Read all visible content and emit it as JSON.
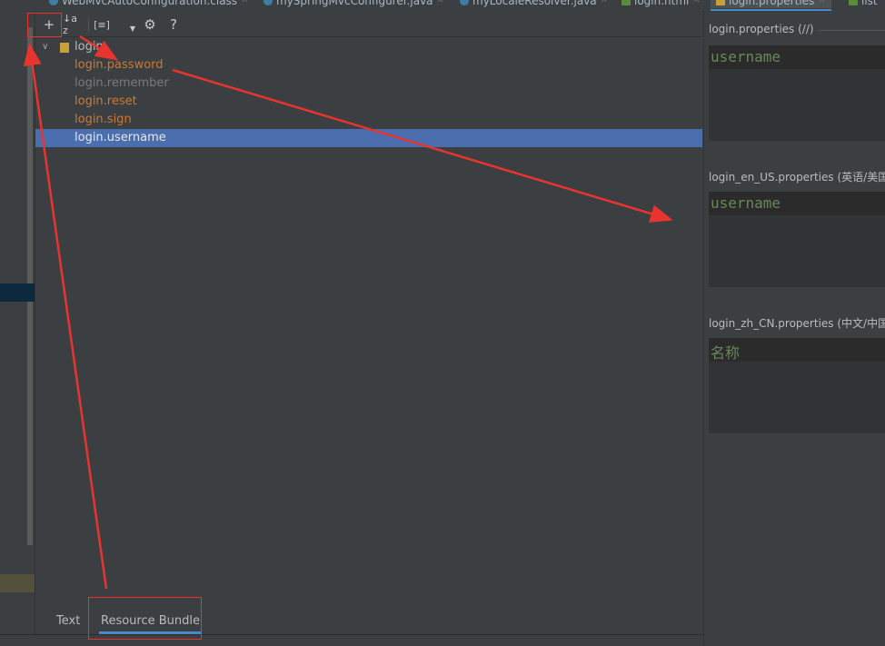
{
  "tabs": [
    {
      "label": "WebMvcAutoConfiguration.class",
      "icon": "class-icon"
    },
    {
      "label": "mySpringMvcConfigurer.java",
      "icon": "class-icon"
    },
    {
      "label": "myLocaleResolver.java",
      "icon": "class-icon"
    },
    {
      "label": "login.html",
      "icon": "html-icon"
    },
    {
      "label": "login.properties",
      "icon": "resource-bundle-icon"
    },
    {
      "label": "list",
      "icon": "html-icon"
    }
  ],
  "toolbar": {
    "add": "+",
    "sort": "↓a z",
    "group": "[≡]",
    "settings": "⚙",
    "help": "?"
  },
  "tree": {
    "root": "login",
    "items": [
      {
        "key": "login.password",
        "state": "incomplete"
      },
      {
        "key": "login.remember",
        "state": "unused"
      },
      {
        "key": "login.reset",
        "state": "incomplete"
      },
      {
        "key": "login.sign",
        "state": "incomplete"
      },
      {
        "key": "login.username",
        "state": "selected"
      }
    ]
  },
  "bottom_tabs": [
    "Text",
    "Resource Bundle"
  ],
  "properties": [
    {
      "file": "login.properties (//)",
      "value": "username"
    },
    {
      "file": "login_en_US.properties (英语/美国)",
      "value": "username"
    },
    {
      "file": "login_zh_CN.properties (中文/中国)",
      "value": "名称"
    }
  ],
  "colors": {
    "background": "#3c3f41",
    "selection": "#4b6eaf",
    "incomplete_key": "#cc7832",
    "value_text": "#6a8759",
    "annotation": "#e8342f"
  }
}
